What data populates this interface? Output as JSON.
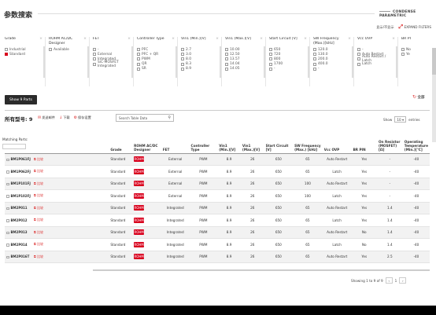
{
  "header": {
    "title": "参数搜索",
    "condense_label": "CONDENSE PARAMETRIC",
    "show_all_label": "显示/不显示",
    "expand_label": "EXPAND FILTERS"
  },
  "filters": [
    {
      "label": "Grade",
      "options": [
        {
          "text": "Industrial",
          "checked": false
        },
        {
          "text": "Standard",
          "checked": true
        }
      ]
    },
    {
      "label": "ROHM AC/DC Designer",
      "options": [
        {
          "text": "Available",
          "checked": false
        }
      ]
    },
    {
      "label": "FET",
      "options": [
        {
          "text": "-",
          "checked": false
        },
        {
          "text": "External",
          "checked": false
        },
        {
          "text": "Integrated",
          "checked": false
        },
        {
          "text": "SiC-MOSFET Integrated",
          "checked": false
        }
      ]
    },
    {
      "label": "Controller Type",
      "options": [
        {
          "text": "PFC",
          "checked": false
        },
        {
          "text": "PFC + QR",
          "checked": false
        },
        {
          "text": "PWM",
          "checked": false
        },
        {
          "text": "QR",
          "checked": false
        },
        {
          "text": "SR",
          "checked": false
        }
      ]
    },
    {
      "label": "Vin1 (Min.)[V]",
      "options": [
        {
          "text": "2.7",
          "checked": false
        },
        {
          "text": "3.0",
          "checked": false
        },
        {
          "text": "8.0",
          "checked": false
        },
        {
          "text": "8.3",
          "checked": false
        },
        {
          "text": "8.9",
          "checked": false
        }
      ]
    },
    {
      "label": "Vin1 (Max.)[V]",
      "options": [
        {
          "text": "10.00",
          "checked": false
        },
        {
          "text": "12.50",
          "checked": false
        },
        {
          "text": "13.57",
          "checked": false
        },
        {
          "text": "14.04",
          "checked": false
        },
        {
          "text": "14.05",
          "checked": false
        }
      ]
    },
    {
      "label": "Start Circuit [V]",
      "options": [
        {
          "text": "650",
          "checked": false
        },
        {
          "text": "720",
          "checked": false
        },
        {
          "text": "800",
          "checked": false
        },
        {
          "text": "1700",
          "checked": false
        },
        {
          "text": "-",
          "checked": false
        }
      ]
    },
    {
      "label": "SW Frequency (Max.)[kHz]",
      "options": [
        {
          "text": "120.0",
          "checked": false
        },
        {
          "text": "130.0",
          "checked": false
        },
        {
          "text": "200.0",
          "checked": false
        },
        {
          "text": "400.0",
          "checked": false
        },
        {
          "text": "-",
          "checked": false
        }
      ]
    },
    {
      "label": "Vcc OVP",
      "options": [
        {
          "text": "-",
          "checked": false
        },
        {
          "text": "Auto Restart",
          "checked": false
        },
        {
          "text": "Auto Restart / Latch",
          "checked": false
        },
        {
          "text": "Latch",
          "checked": false
        }
      ]
    },
    {
      "label": "BR PI",
      "options": [
        {
          "text": "No",
          "checked": false
        },
        {
          "text": "Ye",
          "checked": false
        }
      ]
    }
  ],
  "show_parts_label": "Show 9 Parts",
  "reset_label": "全部",
  "results": {
    "label": "所有型号:",
    "count": "9",
    "actions": [
      "发送邮件",
      "下载",
      "保存设置"
    ],
    "search_placeholder": "Search Table Data",
    "show_label": "Show",
    "entries_value": "10",
    "entries_label": "entries",
    "matching_label": "Matching Parts:"
  },
  "table": {
    "headers": [
      "",
      "",
      "Grade",
      "ROHM AC/DC Designer",
      "FET",
      "Controller Type",
      "Vin1 (Min.)[V]",
      "Vin1 (Max.)[V]",
      "Start Circuit [V]",
      "SW Frequency (Max.) [kHz]",
      "Vcc OVP",
      "BR PIN",
      "On Resistor (MOSFET) [Ω]",
      "Operating Temperature (Min.)[°C]"
    ],
    "compare_label": "比较",
    "rows": [
      {
        "part": "BM1P061FJ",
        "grade": "Standard",
        "fet": "External",
        "ctrl": "PWM",
        "vmin": "8.9",
        "vmax": "26",
        "start": "650",
        "freq": "65",
        "ovp": "Auto Restart",
        "br": "Yes",
        "ron": "-",
        "temp": "-40"
      },
      {
        "part": "BM1P062FJ",
        "grade": "Standard",
        "fet": "External",
        "ctrl": "PWM",
        "vmin": "8.9",
        "vmax": "26",
        "start": "650",
        "freq": "65",
        "ovp": "Latch",
        "br": "Yes",
        "ron": "-",
        "temp": "-40"
      },
      {
        "part": "BM1P101FJ",
        "grade": "Standard",
        "fet": "External",
        "ctrl": "PWM",
        "vmin": "8.9",
        "vmax": "26",
        "start": "650",
        "freq": "100",
        "ovp": "Auto Restart",
        "br": "Yes",
        "ron": "-",
        "temp": "-40"
      },
      {
        "part": "BM1P102FJ",
        "grade": "Standard",
        "fet": "External",
        "ctrl": "PWM",
        "vmin": "8.9",
        "vmax": "26",
        "start": "650",
        "freq": "100",
        "ovp": "Latch",
        "br": "Yes",
        "ron": "-",
        "temp": "-40"
      },
      {
        "part": "BM2P011",
        "grade": "Standard",
        "fet": "Integrated",
        "ctrl": "PWM",
        "vmin": "8.9",
        "vmax": "26",
        "start": "650",
        "freq": "65",
        "ovp": "Auto Restart",
        "br": "Yes",
        "ron": "1.4",
        "temp": "-40"
      },
      {
        "part": "BM2P012",
        "grade": "Standard",
        "fet": "Integrated",
        "ctrl": "PWM",
        "vmin": "8.9",
        "vmax": "26",
        "start": "650",
        "freq": "65",
        "ovp": "Latch",
        "br": "Yes",
        "ron": "1.4",
        "temp": "-40"
      },
      {
        "part": "BM2P013",
        "grade": "Standard",
        "fet": "Integrated",
        "ctrl": "PWM",
        "vmin": "8.9",
        "vmax": "26",
        "start": "650",
        "freq": "65",
        "ovp": "Auto Restart",
        "br": "No",
        "ron": "1.4",
        "temp": "-40"
      },
      {
        "part": "BM2P014",
        "grade": "Standard",
        "fet": "Integrated",
        "ctrl": "PWM",
        "vmin": "8.9",
        "vmax": "26",
        "start": "650",
        "freq": "65",
        "ovp": "Latch",
        "br": "No",
        "ron": "1.4",
        "temp": "-40"
      },
      {
        "part": "BM2P016T",
        "grade": "Standard",
        "fet": "Integrated",
        "ctrl": "PWM",
        "vmin": "8.9",
        "vmax": "26",
        "start": "650",
        "freq": "65",
        "ovp": "Auto Restart",
        "br": "Yes",
        "ron": "2.5",
        "temp": "-40"
      }
    ],
    "designer_icon": "ROHM"
  },
  "pagination": {
    "info": "Showing 1 to 9 of 9",
    "prev": "‹",
    "page": "1",
    "next": "›"
  }
}
